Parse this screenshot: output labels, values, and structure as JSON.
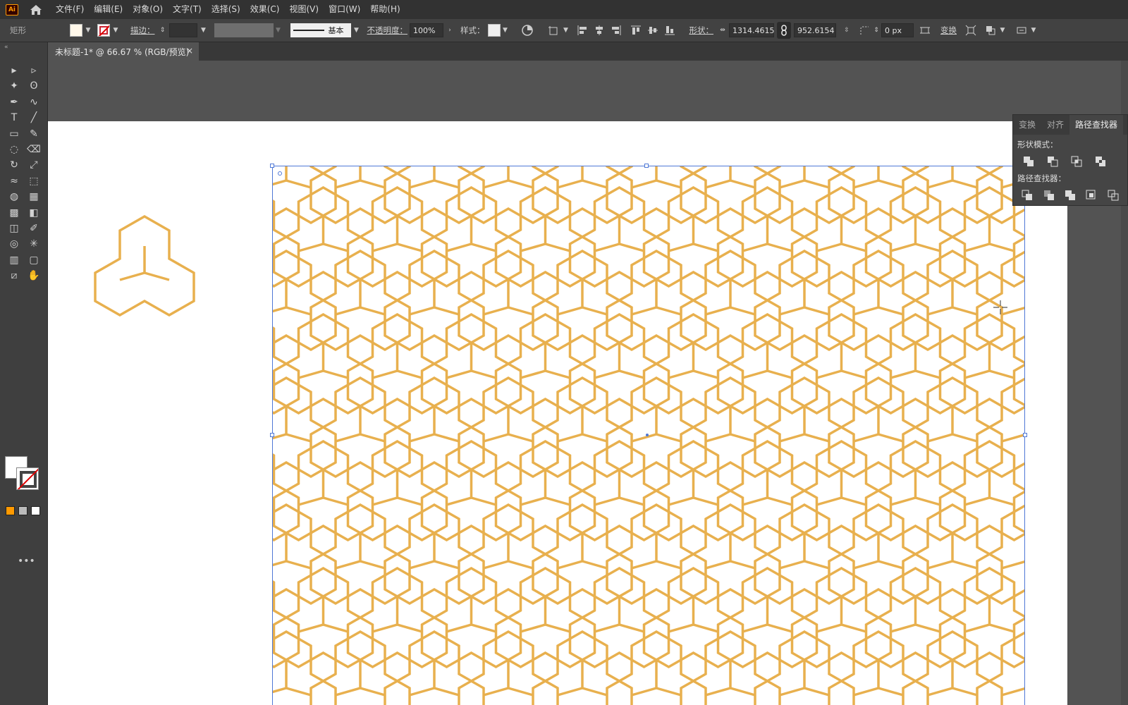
{
  "app": {
    "logo": "Ai"
  },
  "menu": {
    "items": [
      "文件(F)",
      "编辑(E)",
      "对象(O)",
      "文字(T)",
      "选择(S)",
      "效果(C)",
      "视图(V)",
      "窗口(W)",
      "帮助(H)"
    ]
  },
  "control": {
    "tool_name": "矩形",
    "stroke_label": "描边：",
    "stroke_style": "基本",
    "opacity_label": "不透明度：",
    "opacity_value": "100%",
    "style_label": "样式：",
    "shape_label": "形状：",
    "width_value": "1314.4615",
    "height_value": "952.6154",
    "corner_value": "0 px",
    "transform_label": "变换"
  },
  "document": {
    "tab_title": "未标题-1* @ 66.67 % (RGB/预览)",
    "close_glyph": "×"
  },
  "pathfinder": {
    "tabs": [
      "变换",
      "对齐",
      "路径查找器"
    ],
    "active_tab": "路径查找器",
    "shape_modes_label": "形状模式：",
    "pathfinders_label": "路径查找器："
  },
  "colors": {
    "pattern_stroke": "#e8b04e",
    "selection": "#4f78d6",
    "accent": "#ff9a00"
  },
  "icons": [
    "home-icon",
    "selection-tool-icon",
    "direct-selection-tool-icon",
    "magic-wand-icon",
    "lasso-icon",
    "pen-icon",
    "curvature-icon",
    "type-icon",
    "line-icon",
    "rectangle-icon",
    "paintbrush-icon",
    "shaper-icon",
    "eraser-icon",
    "rotate-icon",
    "scale-icon",
    "width-icon",
    "free-transform-icon",
    "shape-builder-icon",
    "perspective-icon",
    "mesh-icon",
    "gradient-icon",
    "eyedropper-icon",
    "blend-icon",
    "symbol-sprayer-icon",
    "column-graph-icon",
    "artboard-icon",
    "slice-icon",
    "hand-icon",
    "zoom-icon"
  ]
}
